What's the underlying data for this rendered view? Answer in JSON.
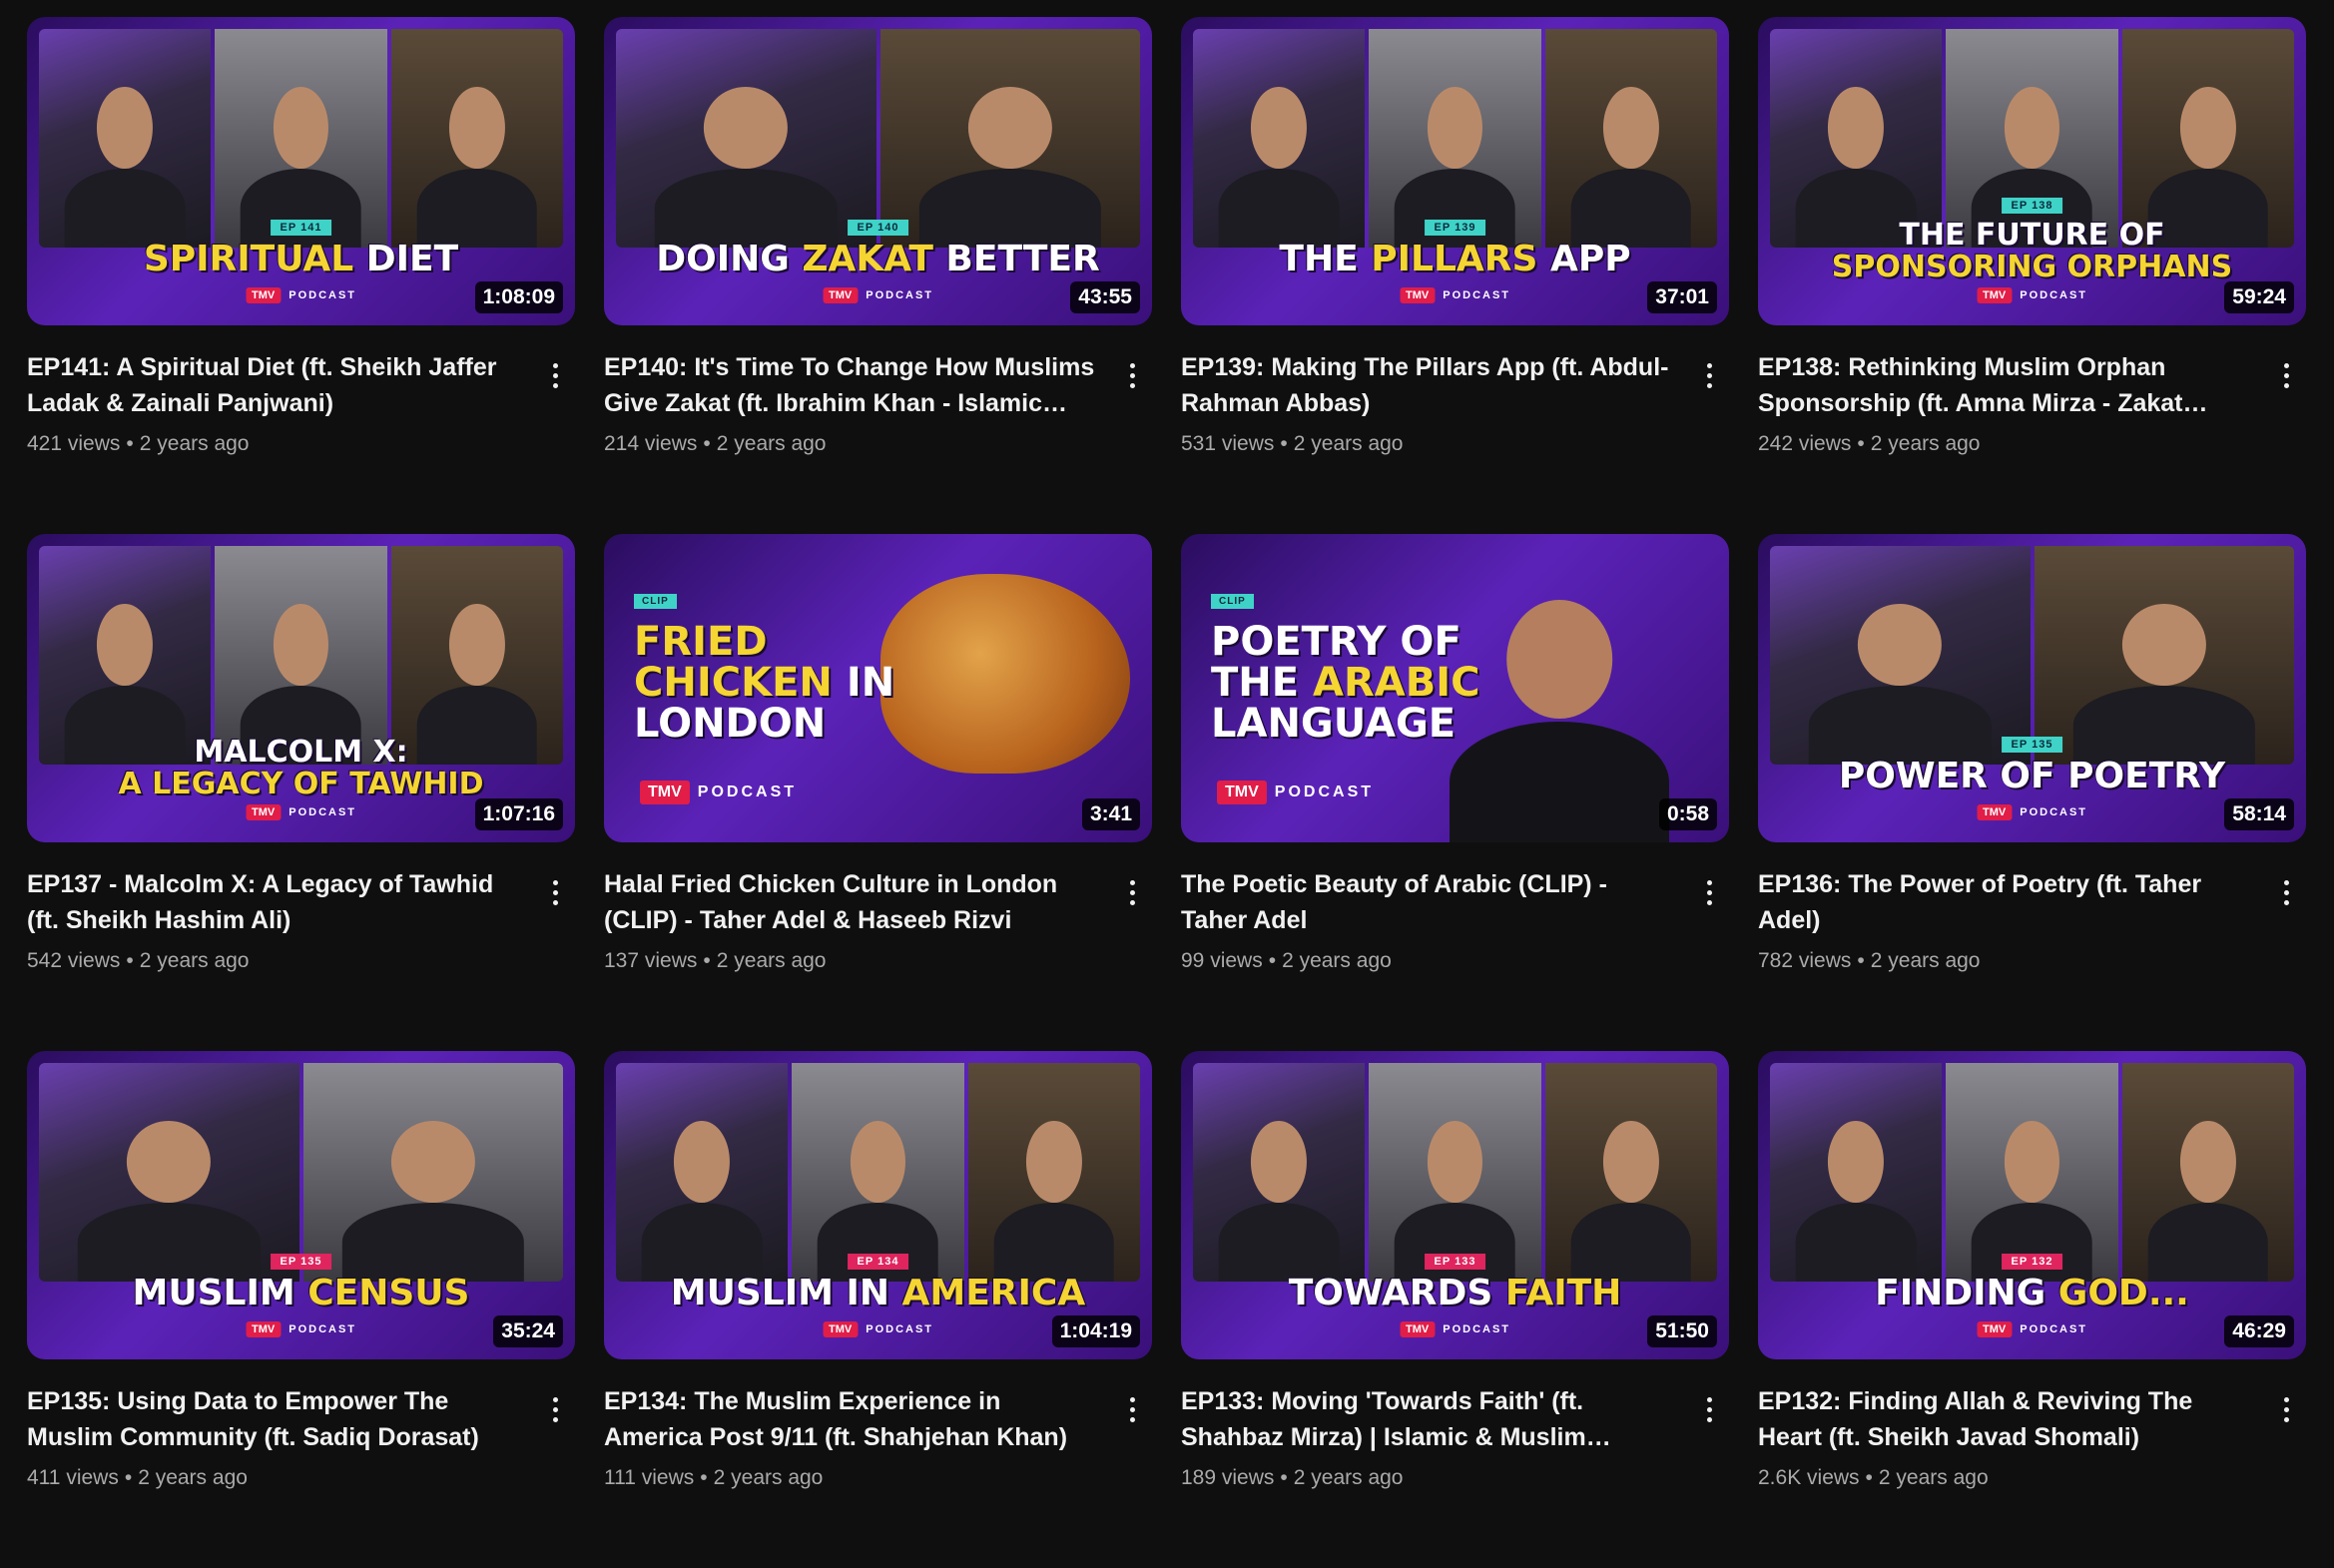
{
  "brand": {
    "logo": "TMV",
    "name": "PODCAST"
  },
  "colors": {
    "background": "#0f0f0f",
    "accent_yellow": "#f5d531",
    "thumb_purple": "#5b22b8",
    "badge_teal": "#3fd3c8",
    "badge_pink": "#e0245e"
  },
  "videos": [
    {
      "title": "EP141: A Spiritual Diet (ft. Sheikh Jaffer Ladak & Zainali Panjwani)",
      "views": "421 views",
      "age": "2 years ago",
      "duration": "1:08:09",
      "ep_badge": "EP 141",
      "thumb_title_1": "SPIRITUAL",
      "thumb_title_2": "DIET"
    },
    {
      "title": "EP140: It's Time To Change How Muslims Give Zakat (ft. Ibrahim Khan - Islamic Relief Worldwide)",
      "views": "214 views",
      "age": "2 years ago",
      "duration": "43:55",
      "ep_badge": "EP 140",
      "thumb_title_1": "DOING",
      "thumb_title_2": "ZAKAT",
      "thumb_title_3": "BETTER"
    },
    {
      "title": "EP139: Making The Pillars App (ft. Abdul-Rahman Abbas)",
      "views": "531 views",
      "age": "2 years ago",
      "duration": "37:01",
      "ep_badge": "EP 139",
      "thumb_title_1": "THE",
      "thumb_title_2": "PILLARS",
      "thumb_title_3": "APP"
    },
    {
      "title": "EP138: Rethinking Muslim Orphan Sponsorship (ft. Amna Mirza - Zakat Foundation)",
      "views": "242 views",
      "age": "2 years ago",
      "duration": "59:24",
      "ep_badge": "EP 138",
      "thumb_title_1": "THE FUTURE OF",
      "thumb_title_2": "SPONSORING ORPHANS"
    },
    {
      "title": "EP137 - Malcolm X: A Legacy of Tawhid (ft. Sheikh Hashim Ali)",
      "views": "542 views",
      "age": "2 years ago",
      "duration": "1:07:16",
      "ep_badge": "",
      "thumb_title_1": "MALCOLM X:",
      "thumb_title_2": "A LEGACY OF TAWHID"
    },
    {
      "title": "Halal Fried Chicken Culture in London (CLIP) - Taher Adel & Haseeb Rizvi",
      "views": "137 views",
      "age": "2 years ago",
      "duration": "3:41",
      "clip_tag": "CLIP",
      "thumb_title_1": "FRIED",
      "thumb_title_2": "CHICKEN",
      "thumb_title_3": "IN",
      "thumb_title_4": "LONDON"
    },
    {
      "title": "The Poetic Beauty of Arabic (CLIP) - Taher Adel",
      "views": "99 views",
      "age": "2 years ago",
      "duration": "0:58",
      "clip_tag": "CLIP",
      "thumb_title_1": "POETRY OF",
      "thumb_title_2": "THE",
      "thumb_title_3": "ARABIC",
      "thumb_title_4": "LANGUAGE"
    },
    {
      "title": "EP136: The Power of Poetry (ft. Taher Adel)",
      "views": "782 views",
      "age": "2 years ago",
      "duration": "58:14",
      "ep_badge": "EP 135",
      "thumb_title_1": "POWER OF POETRY"
    },
    {
      "title": "EP135: Using Data to Empower The Muslim Community (ft. Sadiq Dorasat)",
      "views": "411 views",
      "age": "2 years ago",
      "duration": "35:24",
      "ep_badge": "EP 135",
      "thumb_title_1": "MUSLIM",
      "thumb_title_2": "CENSUS"
    },
    {
      "title": "EP134: The Muslim Experience in America Post 9/11 (ft. Shahjehan Khan)",
      "views": "111 views",
      "age": "2 years ago",
      "duration": "1:04:19",
      "ep_badge": "EP 134",
      "thumb_title_1": "MUSLIM IN",
      "thumb_title_2": "AMERICA"
    },
    {
      "title": "EP133: Moving 'Towards Faith' (ft. Shahbaz Mirza) | Islamic & Muslim Journaling",
      "views": "189 views",
      "age": "2 years ago",
      "duration": "51:50",
      "ep_badge": "EP 133",
      "thumb_title_1": "TOWARDS",
      "thumb_title_2": "FAITH"
    },
    {
      "title": "EP132: Finding Allah & Reviving The Heart (ft. Sheikh Javad Shomali)",
      "views": "2.6K views",
      "age": "2 years ago",
      "duration": "46:29",
      "ep_badge": "EP 132",
      "thumb_title_1": "FINDING",
      "thumb_title_2": "GOD..."
    }
  ]
}
